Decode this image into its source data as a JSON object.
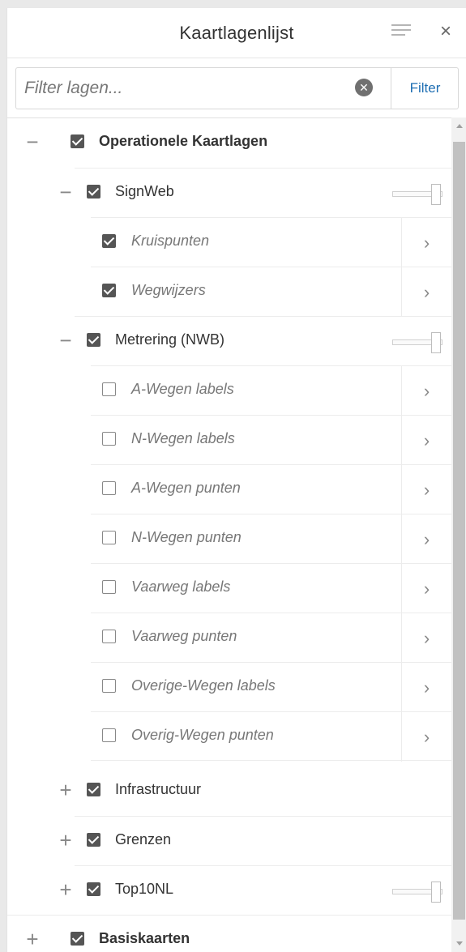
{
  "header": {
    "title": "Kaartlagenlijst",
    "menu_icon": "hamburger-icon",
    "close_glyph": "×"
  },
  "filter": {
    "placeholder": "Filter lagen...",
    "value": "",
    "clear_icon": "clear-circle-icon",
    "clear_glyph": "✕",
    "button_label": "Filter"
  },
  "layers": {
    "group": {
      "toggle": "−",
      "checked": true,
      "label": "Operationele Kaartlagen"
    },
    "signweb": {
      "toggle": "−",
      "checked": true,
      "label": "SignWeb",
      "opacity": 1.0,
      "children": [
        {
          "checked": true,
          "label": "Kruispunten",
          "chevron": "›"
        },
        {
          "checked": true,
          "label": "Wegwijzers",
          "chevron": "›"
        }
      ]
    },
    "metrering": {
      "toggle": "−",
      "checked": true,
      "label": "Metrering (NWB)",
      "opacity": 1.0,
      "children": [
        {
          "checked": false,
          "label": "A-Wegen labels",
          "chevron": "›"
        },
        {
          "checked": false,
          "label": "N-Wegen labels",
          "chevron": "›"
        },
        {
          "checked": false,
          "label": "A-Wegen punten",
          "chevron": "›"
        },
        {
          "checked": false,
          "label": "N-Wegen punten",
          "chevron": "›"
        },
        {
          "checked": false,
          "label": "Vaarweg labels",
          "chevron": "›"
        },
        {
          "checked": false,
          "label": "Vaarweg punten",
          "chevron": "›"
        },
        {
          "checked": false,
          "label": "Overige-Wegen labels",
          "chevron": "›"
        },
        {
          "checked": false,
          "label": "Overig-Wegen punten",
          "chevron": "›"
        }
      ]
    },
    "infrastructuur": {
      "toggle": "+",
      "checked": true,
      "label": "Infrastructuur"
    },
    "grenzen": {
      "toggle": "+",
      "checked": true,
      "label": "Grenzen"
    },
    "top10nl": {
      "toggle": "+",
      "checked": true,
      "label": "Top10NL",
      "opacity": 1.0
    },
    "basiskaarten": {
      "toggle": "+",
      "checked": true,
      "label": "Basiskaarten"
    }
  },
  "colors": {
    "accent": "#1f6fb3",
    "checkbox_checked": "#555555",
    "muted_text": "#777777"
  }
}
